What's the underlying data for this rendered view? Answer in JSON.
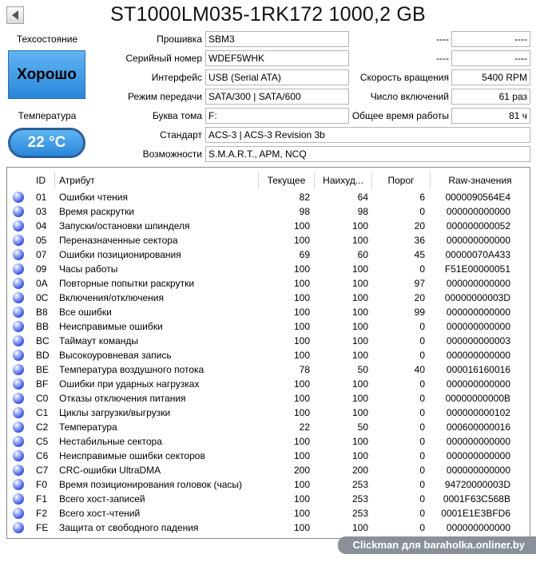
{
  "title": "ST1000LM035-1RK172 1000,2 GB",
  "health": {
    "label": "Техсостояние",
    "value": "Хорошо"
  },
  "temperature": {
    "label": "Температура",
    "value": "22 °C"
  },
  "info": {
    "firmware": {
      "label": "Прошивка",
      "value": "SBM3"
    },
    "serial": {
      "label": "Серийный номер",
      "value": "WDEF5WHK"
    },
    "interface": {
      "label": "Интерфейс",
      "value": "USB (Serial ATA)"
    },
    "transfer": {
      "label": "Режим передачи",
      "value": "SATA/300 | SATA/600"
    },
    "drive_letter": {
      "label": "Буква тома",
      "value": "F:"
    },
    "standard": {
      "label": "Стандарт",
      "value": "ACS-3 | ACS-3 Revision 3b"
    },
    "features": {
      "label": "Возможности",
      "value": "S.M.A.R.T., APM, NCQ"
    },
    "blank1": {
      "label": "----",
      "value": "----"
    },
    "blank2": {
      "label": "----",
      "value": "----"
    },
    "rotation": {
      "label": "Скорость вращения",
      "value": "5400 RPM"
    },
    "power_count": {
      "label": "Число включений",
      "value": "61 раз"
    },
    "power_hours": {
      "label": "Общее время работы",
      "value": "81 ч"
    }
  },
  "table": {
    "headers": [
      "ID",
      "Атрибут",
      "Текущее",
      "Наихуд...",
      "Порог",
      "Raw-значения"
    ],
    "rows": [
      [
        "01",
        "Ошибки чтения",
        "82",
        "64",
        "6",
        "0000090564E4"
      ],
      [
        "03",
        "Время раскрутки",
        "98",
        "98",
        "0",
        "000000000000"
      ],
      [
        "04",
        "Запуски/остановки шпинделя",
        "100",
        "100",
        "20",
        "000000000052"
      ],
      [
        "05",
        "Переназначенные сектора",
        "100",
        "100",
        "36",
        "000000000000"
      ],
      [
        "07",
        "Ошибки позиционирования",
        "69",
        "60",
        "45",
        "00000070A433"
      ],
      [
        "09",
        "Часы работы",
        "100",
        "100",
        "0",
        "F51E00000051"
      ],
      [
        "0A",
        "Повторные попытки раскрутки",
        "100",
        "100",
        "97",
        "000000000000"
      ],
      [
        "0C",
        "Включения/отключения",
        "100",
        "100",
        "20",
        "00000000003D"
      ],
      [
        "B8",
        "Все ошибки",
        "100",
        "100",
        "99",
        "000000000000"
      ],
      [
        "BB",
        "Неисправимые ошибки",
        "100",
        "100",
        "0",
        "000000000000"
      ],
      [
        "BC",
        "Таймаут команды",
        "100",
        "100",
        "0",
        "000000000003"
      ],
      [
        "BD",
        "Высокоуровневая запись",
        "100",
        "100",
        "0",
        "000000000000"
      ],
      [
        "BE",
        "Температура воздушного потока",
        "78",
        "50",
        "40",
        "000016160016"
      ],
      [
        "BF",
        "Ошибки при ударных нагрузках",
        "100",
        "100",
        "0",
        "000000000000"
      ],
      [
        "C0",
        "Отказы отключения питания",
        "100",
        "100",
        "0",
        "00000000000B"
      ],
      [
        "C1",
        "Циклы загрузки/выгрузки",
        "100",
        "100",
        "0",
        "000000000102"
      ],
      [
        "C2",
        "Температура",
        "22",
        "50",
        "0",
        "000600000016"
      ],
      [
        "C5",
        "Нестабильные сектора",
        "100",
        "100",
        "0",
        "000000000000"
      ],
      [
        "C6",
        "Неисправимые ошибки секторов",
        "100",
        "100",
        "0",
        "000000000000"
      ],
      [
        "C7",
        "CRC-ошибки UltraDMA",
        "200",
        "200",
        "0",
        "000000000000"
      ],
      [
        "F0",
        "Время позиционирования головок (часы)",
        "100",
        "253",
        "0",
        "94720000003D"
      ],
      [
        "F1",
        "Всего хост-записей",
        "100",
        "253",
        "0",
        "0001F63C568B"
      ],
      [
        "F2",
        "Всего хост-чтений",
        "100",
        "253",
        "0",
        "0001E1E3BFD6"
      ],
      [
        "FE",
        "Защита от свободного падения",
        "100",
        "100",
        "0",
        "000000000000"
      ]
    ]
  },
  "watermark": "Clickman для baraholka.onliner.by"
}
